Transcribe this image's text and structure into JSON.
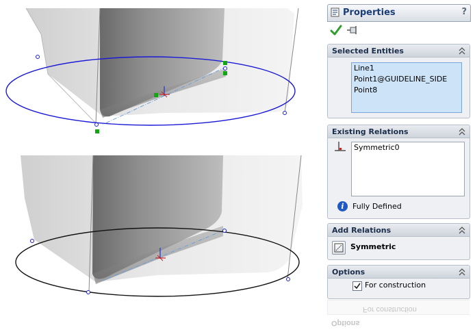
{
  "panel": {
    "title": "Properties",
    "help": "?",
    "selected_entities": {
      "header": "Selected Entities",
      "items": [
        "Line1",
        "Point1@GUIDELINE_SIDE",
        "Point8"
      ]
    },
    "existing_relations": {
      "header": "Existing Relations",
      "items": [
        "Symmetric0"
      ],
      "status": "Fully Defined"
    },
    "add_relations": {
      "header": "Add Relations",
      "symmetric_label": "Symmetric"
    },
    "options": {
      "header": "Options",
      "construction_label": "For construction",
      "construction_checked": true
    }
  },
  "colors": {
    "selected_sketch": "#1a1ad6",
    "sketch": "#111111",
    "selection_fill": "#cde3f8",
    "header_text": "#1b3d78"
  }
}
